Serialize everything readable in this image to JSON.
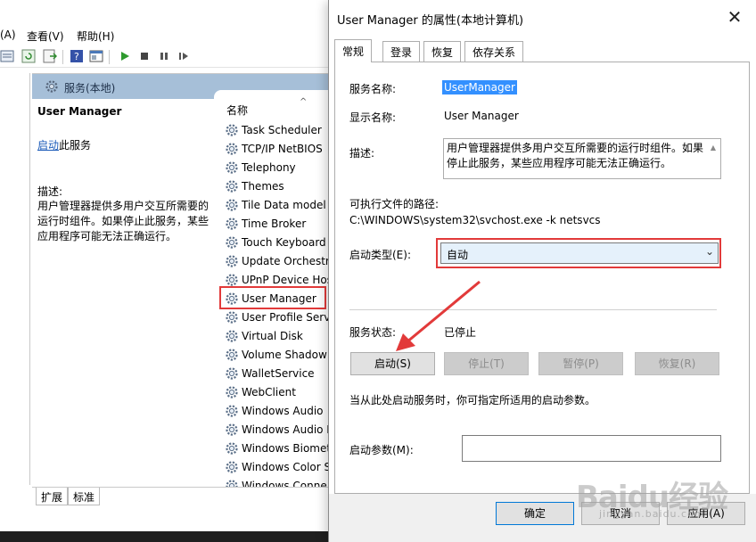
{
  "menu": [
    "(A)",
    "查看(V)",
    "帮助(H)"
  ],
  "panel": {
    "title": "服务(本地)",
    "column_name": "名称",
    "desc": {
      "service_name": "User Manager",
      "start_link": "启动",
      "start_suffix": "此服务",
      "label": "描述:",
      "text": "用户管理器提供多用户交互所需要的运行时组件。如果停止此服务，某些应用程序可能无法正确运行。"
    },
    "services": [
      "Task Scheduler",
      "TCP/IP NetBIOS",
      "Telephony",
      "Themes",
      "Tile Data model",
      "Time Broker",
      "Touch Keyboard",
      "Update Orchestr",
      "UPnP Device Hos",
      "User Manager",
      "User Profile Serv",
      "Virtual Disk",
      "Volume Shadow",
      "WalletService",
      "WebClient",
      "Windows Audio",
      "Windows Audio I",
      "Windows Biomet",
      "Windows Color S",
      "Windows Conne"
    ],
    "selected_service": "User Manager",
    "bottom_tabs": [
      "扩展",
      "标准"
    ]
  },
  "dialog": {
    "title": "User Manager 的属性(本地计算机)",
    "close_glyph": "✕",
    "tabs": [
      "常规",
      "登录",
      "恢复",
      "依存关系"
    ],
    "active_tab": "常规",
    "service_name_label": "服务名称:",
    "service_name_value": "UserManager",
    "display_name_label": "显示名称:",
    "display_name_value": "User Manager",
    "description_label": "描述:",
    "description_value": "用户管理器提供多用户交互所需要的运行时组件。如果停止此服务，某些应用程序可能无法正确运行。",
    "path_label": "可执行文件的路径:",
    "path_value": "C:\\WINDOWS\\system32\\svchost.exe -k netsvcs",
    "startup_type_label": "启动类型(E):",
    "startup_type_value": "自动",
    "status_label": "服务状态:",
    "status_value": "已停止",
    "buttons": {
      "start": "启动(S)",
      "stop": "停止(T)",
      "pause": "暂停(P)",
      "resume": "恢复(R)"
    },
    "hint": "当从此处启动服务时，你可指定所适用的启动参数。",
    "params_label": "启动参数(M):",
    "params_value": "",
    "ok": "确定",
    "cancel": "取消",
    "apply": "应用(A)"
  },
  "watermark": {
    "logo": "Baidu经验",
    "sub": "jingyan.baidu.com"
  },
  "colors": {
    "highlight_red": "#e23a3a",
    "selection_blue": "#3390ff",
    "header_blue": "#a6bfd8"
  }
}
